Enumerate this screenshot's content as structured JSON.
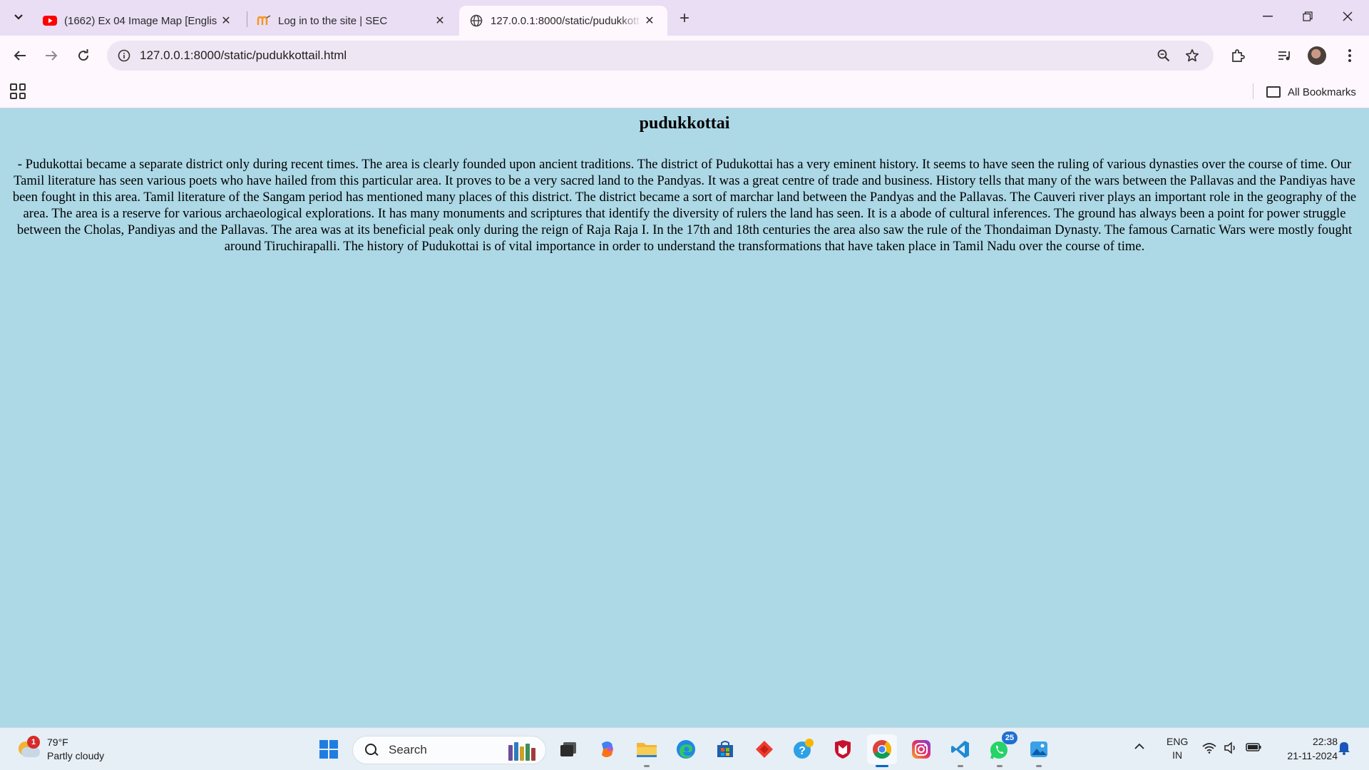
{
  "browser": {
    "tabs": [
      {
        "title": "(1662) Ex 04 Image Map [Englis",
        "favicon": "youtube-icon",
        "active": false
      },
      {
        "title": "Log in to the site | SEC",
        "favicon": "moodle-icon",
        "active": false
      },
      {
        "title": "127.0.0.1:8000/static/pudukkott",
        "favicon": "globe-icon",
        "active": true
      }
    ],
    "url": "127.0.0.1:8000/static/pudukkottail.html",
    "bookmarks_label": "All Bookmarks"
  },
  "page": {
    "heading": "pudukkottai",
    "paragraph": "- Pudukottai became a separate district only during recent times. The area is clearly founded upon ancient traditions. The district of Pudukottai has a very eminent history. It seems to have seen the ruling of various dynasties over the course of time. Our Tamil literature has seen various poets who have hailed from this particular area. It proves to be a very sacred land to the Pandyas. It was a great centre of trade and business. History tells that many of the wars between the Pallavas and the Pandiyas have been fought in this area. Tamil literature of the Sangam period has mentioned many places of this district. The district became a sort of marchar land between the Pandyas and the Pallavas. The Cauveri river plays an important role in the geography of the area. The area is a reserve for various archaeological explorations. It has many monuments and scriptures that identify the diversity of rulers the land has seen. It is a abode of cultural inferences. The ground has always been a point for power struggle between the Cholas, Pandiyas and the Pallavas. The area was at its beneficial peak only during the reign of Raja Raja I. In the 17th and 18th centuries the area also saw the rule of the Thondaiman Dynasty. The famous Carnatic Wars were mostly fought around Tiruchirapalli. The history of Pudukottai is of vital importance in order to understand the transformations that have taken place in Tamil Nadu over the course of time.",
    "background_color": "#add8e6"
  },
  "taskbar": {
    "weather": {
      "badge": "1",
      "temp": "79°F",
      "condition": "Partly cloudy"
    },
    "search_placeholder": "Search",
    "whatsapp_badge": "25",
    "lang_line1": "ENG",
    "lang_line2": "IN",
    "time": "22:38",
    "date": "21-11-2024"
  }
}
